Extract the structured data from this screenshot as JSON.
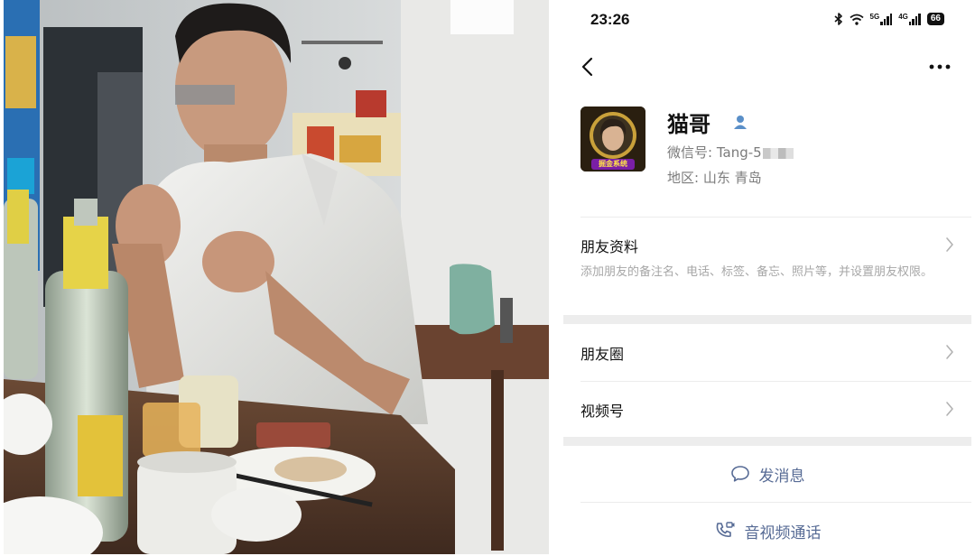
{
  "status_bar": {
    "time": "23:26",
    "network_1": "5G",
    "network_2": "4G",
    "battery": "66"
  },
  "nav": {
    "back_icon": "chevron-left-icon",
    "more_icon": "more-dots-icon"
  },
  "profile": {
    "nickname": "猫哥",
    "wechat_id_label": "微信号: ",
    "wechat_id_visible": "Tang-5",
    "region_label": "地区: ",
    "region_value": "山东  青岛",
    "avatar_tag": "掘金系统"
  },
  "menu": {
    "friend_info_label": "朋友资料",
    "friend_info_desc": "添加朋友的备注名、电话、标签、备忘、照片等，并设置朋友权限。",
    "moments_label": "朋友圈",
    "channels_label": "视频号"
  },
  "actions": {
    "send_message_label": "发消息",
    "av_call_label": "音视频通话"
  },
  "colors": {
    "link_blue": "#576b95",
    "gray_text": "#7b7b7b",
    "desc_text": "#a7a7a7",
    "divider": "#ededed"
  }
}
